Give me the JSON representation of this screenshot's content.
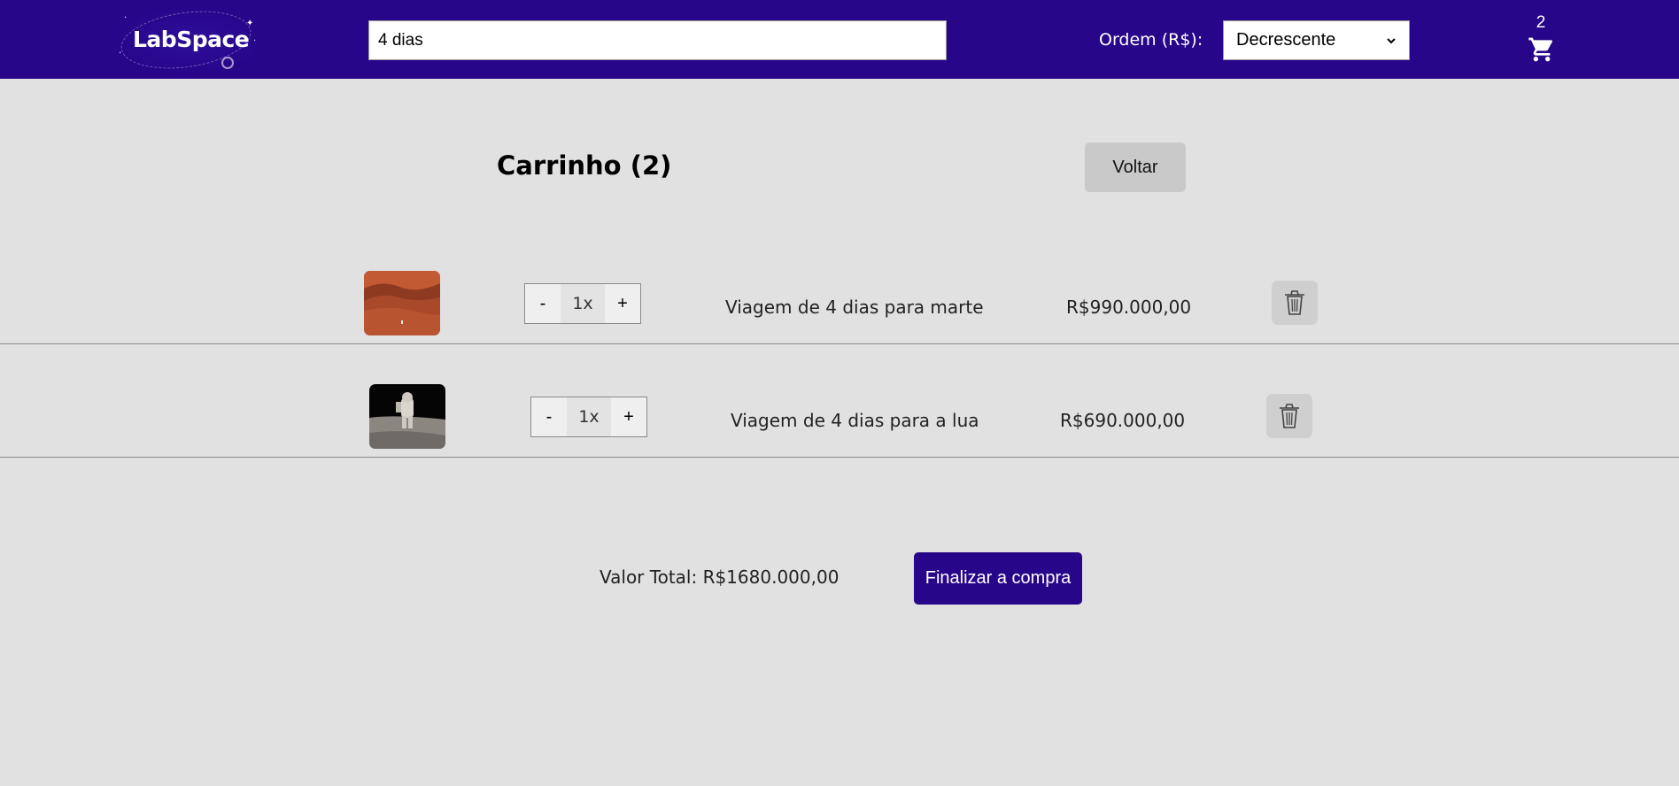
{
  "header": {
    "logo_text": "LabSpace",
    "search": {
      "value": "4 dias",
      "placeholder": ""
    },
    "order_label": "Ordem (R$):",
    "order_selected": "Decrescente",
    "cart_count": "2",
    "cart_icon": "cart-icon",
    "brand_color": "#27068a"
  },
  "main": {
    "title": "Carrinho (2)",
    "back_label": "Voltar",
    "items": [
      {
        "image": "mars-thumbnail",
        "qty_minus": "-",
        "qty": "1x",
        "qty_plus": "+",
        "name": "Viagem de 4 dias para marte",
        "price": "R$990.000,00",
        "delete_icon": "trash-icon"
      },
      {
        "image": "moon-astronaut-thumbnail",
        "qty_minus": "-",
        "qty": "1x",
        "qty_plus": "+",
        "name": "Viagem de 4 dias para a lua",
        "price": "R$690.000,00",
        "delete_icon": "trash-icon"
      }
    ],
    "total_label": "Valor Total: R$1680.000,00",
    "finish_label": "Finalizar a compra"
  }
}
